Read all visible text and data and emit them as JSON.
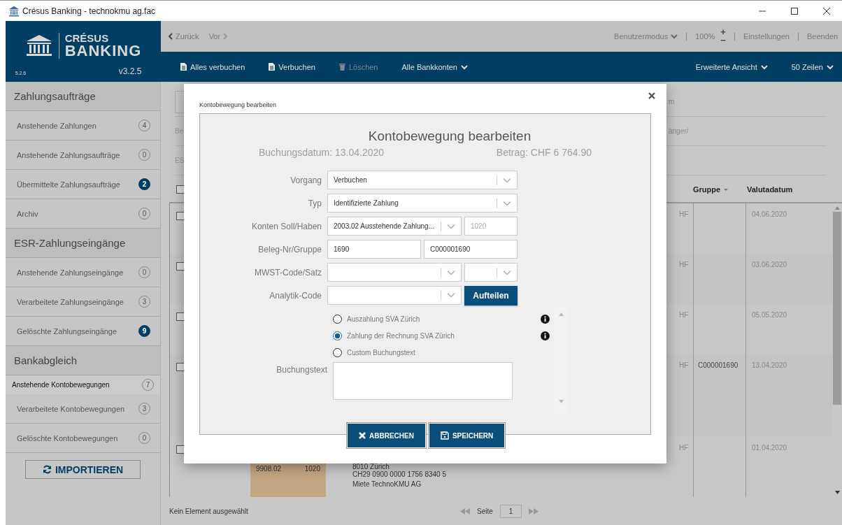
{
  "window": {
    "title": "Crésus Banking - technokmu ag.fac"
  },
  "logo": {
    "brand_top": "CRÉSUS",
    "brand": "BANKING",
    "build": "5.2.6",
    "version": "v3.2.5"
  },
  "nav": {
    "back": "Zurück",
    "forward": "Vor",
    "mode": "Benutzermodus",
    "zoom": "100%",
    "zoom_in": "+",
    "zoom_out": "−",
    "links": [
      "Einstellungen",
      "Beenden"
    ]
  },
  "toolbar": {
    "items": [
      {
        "label": "Alles verbuchen",
        "kind": "doc",
        "disabled": false
      },
      {
        "label": "Verbuchen",
        "kind": "doc",
        "disabled": false
      },
      {
        "label": "Löschen",
        "kind": "trash",
        "disabled": true
      },
      {
        "label": "Alle Bankkonten",
        "kind": "dropdown",
        "disabled": false
      }
    ],
    "right": [
      "Erweiterte Ansicht",
      "50 Zeilen"
    ]
  },
  "sidebar": {
    "sections": [
      {
        "title": "Zahlungsaufträge",
        "items": [
          {
            "label": "Anstehende Zahlungen",
            "count": "4",
            "highlighted": false,
            "selected": false
          },
          {
            "label": "Anstehende Zahlungsaufträge",
            "count": "0",
            "highlighted": false,
            "selected": false
          },
          {
            "label": "Übermittelte Zahlungsaufträge",
            "count": "2",
            "highlighted": true,
            "selected": false
          },
          {
            "label": "Archiv",
            "count": "0",
            "highlighted": false,
            "selected": false
          }
        ]
      },
      {
        "title": "ESR-Zahlungseingänge",
        "items": [
          {
            "label": "Anstehende Zahlungseingänge",
            "count": "0",
            "highlighted": false,
            "selected": false
          },
          {
            "label": "Verarbeitete Zahlungseingänge",
            "count": "3",
            "highlighted": false,
            "selected": false
          },
          {
            "label": "Gelöschte Zahlungseingänge",
            "count": "9",
            "highlighted": true,
            "selected": false
          }
        ]
      },
      {
        "title": "Bankabgleich",
        "items": [
          {
            "label": "Anstehende Kontobewegungen",
            "count": "7",
            "highlighted": false,
            "selected": true
          },
          {
            "label": "Verarbeitete Kontobewegungen",
            "count": "3",
            "highlighted": false,
            "selected": false
          },
          {
            "label": "Gelöschte Kontobewegungen",
            "count": "0",
            "highlighted": false,
            "selected": false
          }
        ]
      }
    ],
    "import_button": "IMPORTIEREN"
  },
  "filters": [
    {
      "right": "m"
    },
    {
      "left": "Be",
      "right": "änger/"
    },
    {
      "left": "ES"
    }
  ],
  "table": {
    "header_checked": false,
    "columns": [
      {
        "label": "Gruppe",
        "sortable": true
      },
      {
        "label": "Valutadatum",
        "sortable": false
      }
    ],
    "rows": [
      {
        "checked": false,
        "currency": "HF",
        "group": "",
        "date": "04.06.2020"
      },
      {
        "checked": false,
        "currency": "HF",
        "group": "",
        "date": "03.06.2020"
      },
      {
        "checked": false,
        "currency": "HF",
        "group": "",
        "date": "05.05.2020"
      },
      {
        "checked": false,
        "currency": "HF",
        "group": "C000001690",
        "date": "13.04.2020"
      },
      {
        "checked": false,
        "currency": "HF",
        "group": "",
        "date": "01.04.2020",
        "accounts": [
          "9908.02",
          "1020"
        ],
        "details": [
          "8010 Zürich",
          "CH29 0900 0000 1756 8340 5",
          "Miete TechnoKMU AG"
        ]
      }
    ]
  },
  "footer": {
    "status": "Kein Element ausgewählt",
    "page_label": "Seite",
    "page": "1"
  },
  "modal": {
    "title": "Kontobewegung bearbeiten",
    "heading": "Kontobewegung bearbeiten",
    "date": "Buchungsdatum: 13.04.2020",
    "amount": "Betrag: CHF 6 764.90",
    "rows": [
      {
        "label": "Vorgang",
        "controls": [
          {
            "kind": "select",
            "value": "Verbuchen"
          }
        ]
      },
      {
        "label": "Typ",
        "controls": [
          {
            "kind": "select",
            "value": "Identifizierte Zahlung"
          }
        ]
      },
      {
        "label": "Konten Soll/Haben",
        "controls": [
          {
            "kind": "select",
            "value": "2003.02 Ausstehende Zahlung..."
          },
          {
            "kind": "input",
            "value": "1020",
            "disabled": true
          }
        ]
      },
      {
        "label": "Beleg-Nr/Gruppe",
        "controls": [
          {
            "kind": "input",
            "value": "1690",
            "disabled": false
          },
          {
            "kind": "input",
            "value": "C000001690",
            "disabled": false
          }
        ]
      },
      {
        "label": "MWST-Code/Satz",
        "controls": [
          {
            "kind": "select"
          },
          {
            "kind": "select"
          }
        ]
      },
      {
        "label": "Analytik-Code",
        "controls": [
          {
            "kind": "select"
          },
          {
            "kind": "button",
            "value": "Aufteilen"
          }
        ]
      }
    ],
    "options": [
      {
        "label": "Auszahlung SVA Zürich",
        "selected": false,
        "info": true
      },
      {
        "label": "Zahlung der Rechnung SVA Zürich",
        "selected": true,
        "info": true
      },
      {
        "label": "Custom Buchungstext",
        "selected": false,
        "info": false
      }
    ],
    "text_label": "Buchungstext",
    "buttons": [
      {
        "label": "ABBRECHEN",
        "kind": "cancel"
      },
      {
        "label": "SPEICHERN",
        "kind": "save"
      }
    ]
  }
}
